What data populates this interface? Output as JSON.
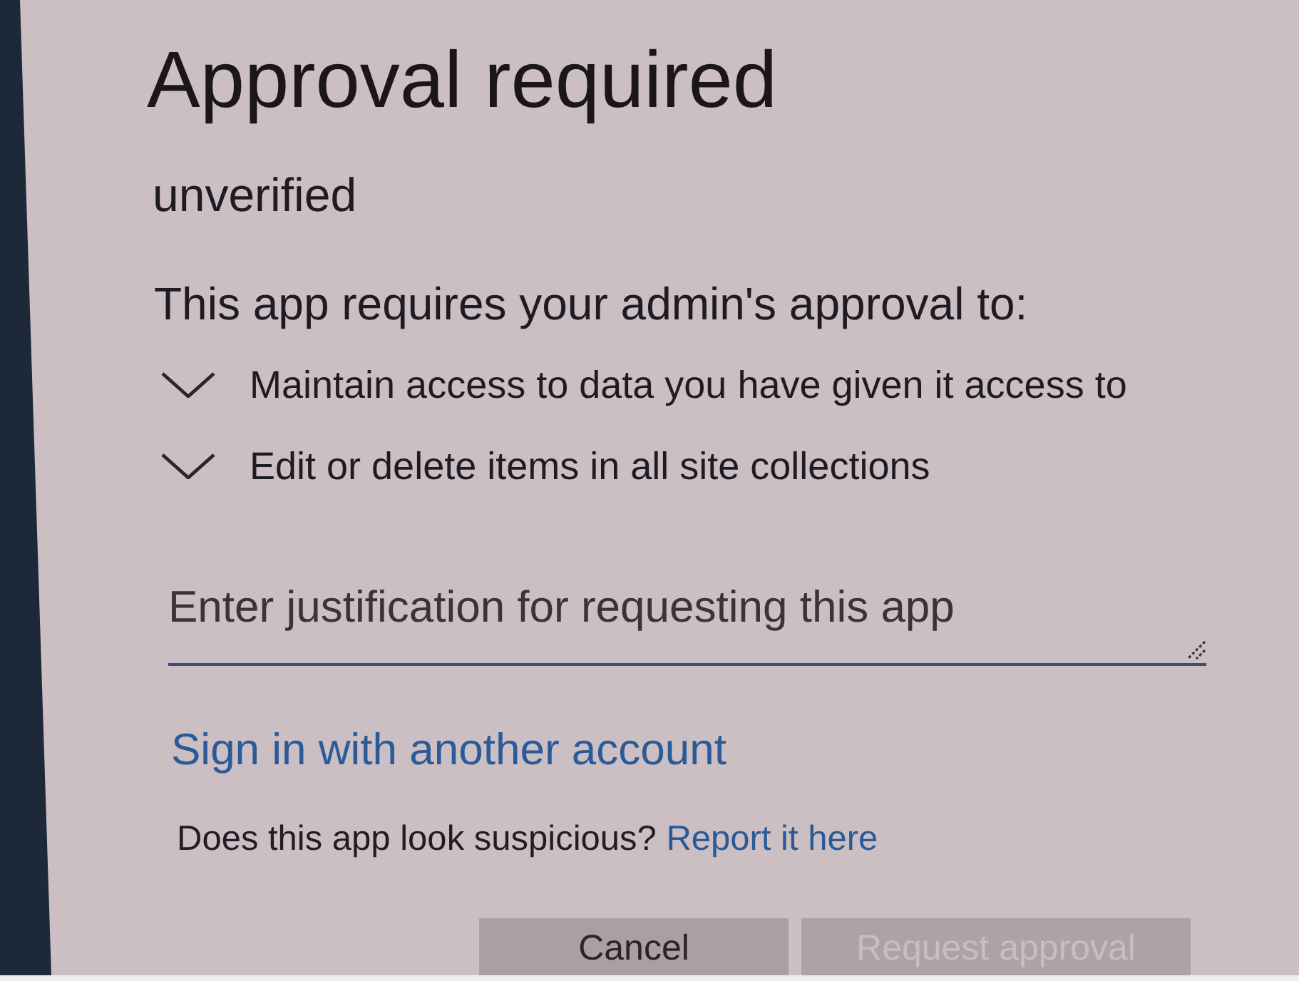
{
  "dialog": {
    "title": "Approval required",
    "subtitle": "unverified",
    "intro": "This app requires your admin's approval to:",
    "permissions": [
      {
        "label": "Maintain access to data you have given it access to",
        "expanded": false
      },
      {
        "label": "Edit or delete items in all site collections",
        "expanded": false
      }
    ],
    "justification": {
      "placeholder": "Enter justification for requesting this app"
    },
    "switch_account_link": "Sign in with another account",
    "report": {
      "text": "Does this app look suspicious?",
      "link": "Report it here"
    },
    "buttons": [
      {
        "label": "Cancel",
        "disabled": false
      },
      {
        "label": "Request approval",
        "disabled": true
      }
    ]
  }
}
